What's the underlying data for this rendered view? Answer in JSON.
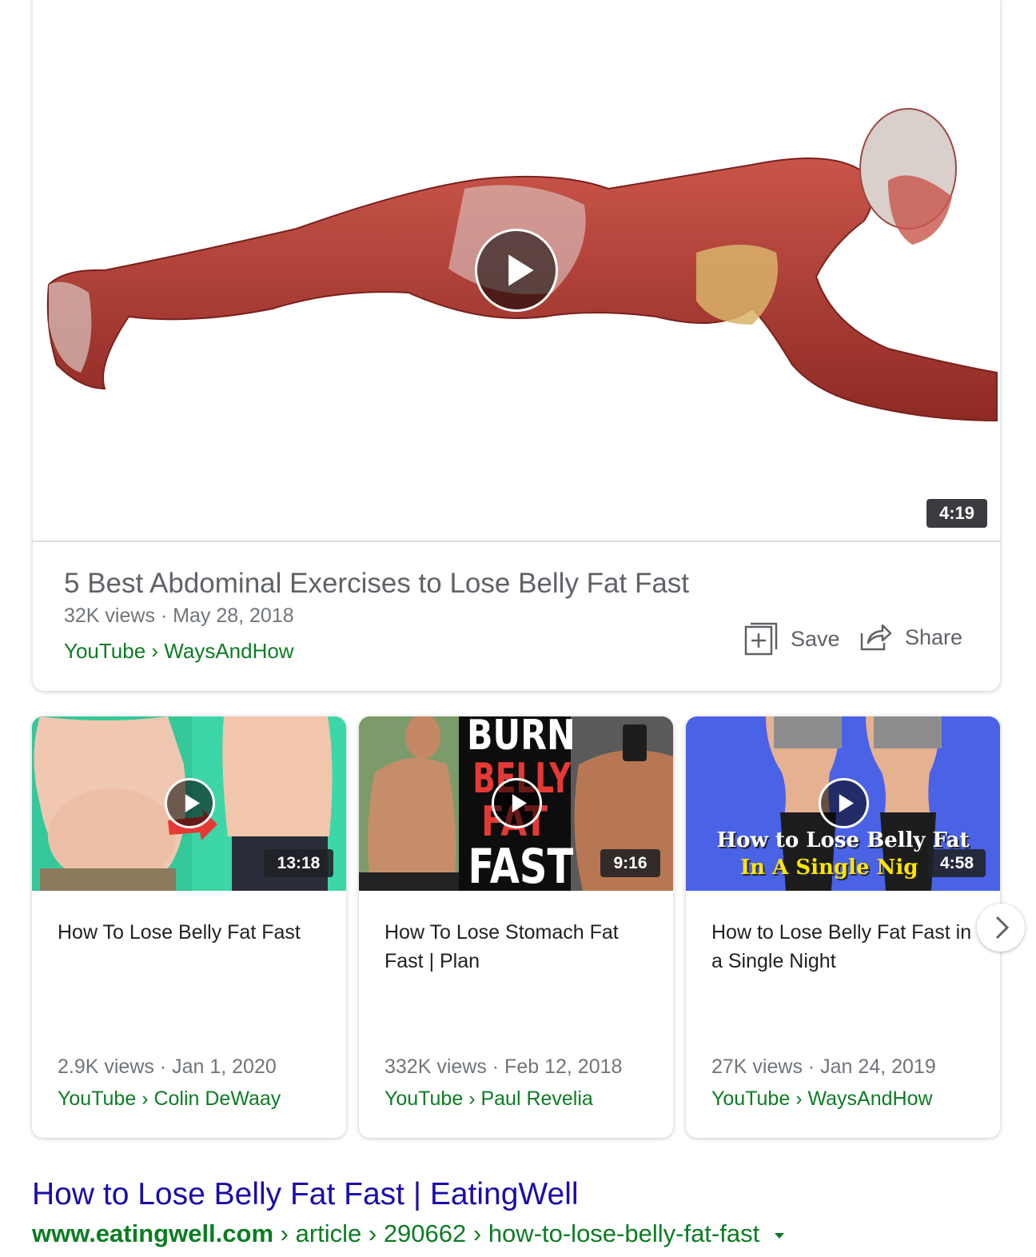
{
  "main_video": {
    "duration": "4:19",
    "title": "5 Best Abdominal Exercises to Lose Belly Fat Fast",
    "meta": "32K views · May 28, 2018",
    "source": "YouTube › WaysAndHow",
    "save_label": "Save",
    "share_label": "Share"
  },
  "videos": [
    {
      "duration": "13:18",
      "title": "How To Lose Belly Fat Fast",
      "meta": "2.9K views · Jan 1, 2020",
      "source": "YouTube › Colin DeWaay"
    },
    {
      "duration": "9:16",
      "title": "How To Lose Stomach Fat Fast | Plan",
      "meta": "332K views · Feb 12, 2018",
      "source": "YouTube › Paul Revelia",
      "thumb_text": [
        "BURN",
        "BELLY",
        "FAT",
        "FAST"
      ]
    },
    {
      "duration": "4:58",
      "title": "How to Lose Belly Fat Fast in a Single Night",
      "meta": "27K views · Jan 24, 2019",
      "source": "YouTube › WaysAndHow",
      "thumb_text": [
        "How to Lose Belly Fat",
        "In A Single Nig"
      ]
    }
  ],
  "result": {
    "title": "How to Lose Belly Fat Fast | EatingWell",
    "url_domain": "www.eatingwell.com",
    "url_path": " › article › 290662 › how-to-lose-belly-fat-fast"
  },
  "colors": {
    "link": "#1a0dab",
    "url_green": "#0c7c23",
    "meta_gray": "#70757a",
    "thumb3_bg": "#4a62e6",
    "thumb1_bg": "#3dd6a8"
  },
  "icons": [
    "play-icon",
    "save-icon",
    "share-icon",
    "chevron-right-icon",
    "dropdown-caret-icon"
  ]
}
